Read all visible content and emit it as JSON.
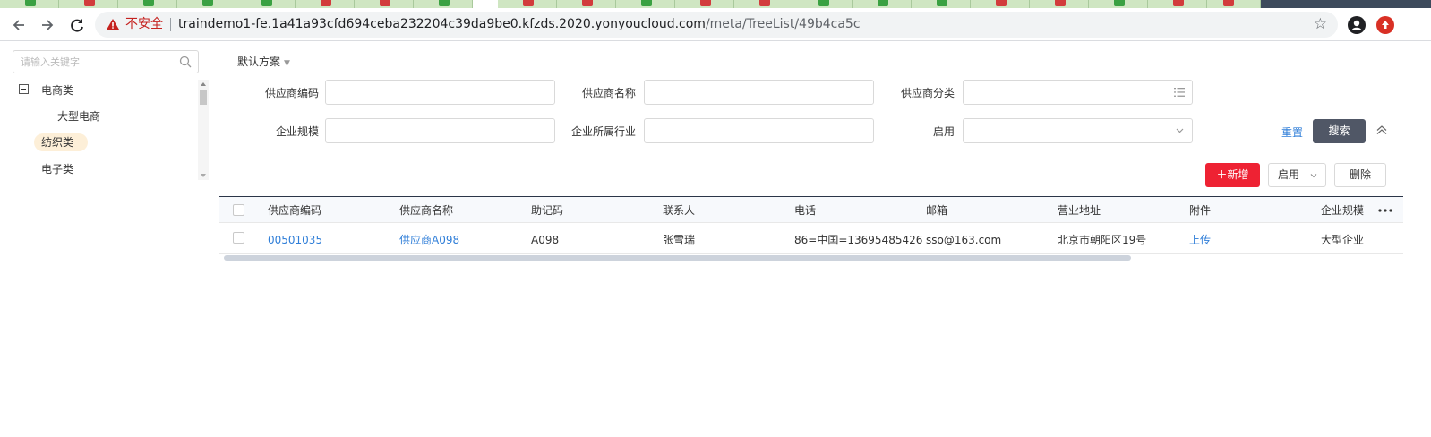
{
  "browser": {
    "security_label": "不安全",
    "url_host": "traindemo1-fe.1a41a93cfd694ceba232204c39da9be0.kfzds.2020.yonyoucloud.com",
    "url_path": "/meta/TreeList/49b4ca5c",
    "back_icon": "arrow-left-icon",
    "forward_icon": "arrow-right-icon",
    "reload_icon": "reload-icon",
    "bookmark_icon": "star-icon",
    "warning_color": "#c5221f"
  },
  "sidebar": {
    "search_placeholder": "请输入关键字",
    "tree": [
      {
        "label": "电商类",
        "expanded": true
      },
      {
        "label": "大型电商"
      },
      {
        "label": "纺织类",
        "selected": true
      },
      {
        "label": "电子类"
      }
    ]
  },
  "filter": {
    "scheme_label": "默认方案",
    "fields": [
      {
        "label": "供应商编码",
        "value": ""
      },
      {
        "label": "供应商名称",
        "value": ""
      },
      {
        "label": "供应商分类",
        "value": ""
      },
      {
        "label": "企业规模",
        "value": ""
      },
      {
        "label": "企业所属行业",
        "value": ""
      },
      {
        "label": "启用",
        "value": ""
      }
    ],
    "reset_label": "重置",
    "search_label": "搜索"
  },
  "actions": {
    "add_label": "新增",
    "enable_label": "启用",
    "delete_label": "删除",
    "add_color": "#ee2233"
  },
  "table": {
    "columns": [
      "供应商编码",
      "供应商名称",
      "助记码",
      "联系人",
      "电话",
      "邮箱",
      "营业地址",
      "附件",
      "企业规模"
    ],
    "rows": [
      [
        "00501035",
        "供应商A098",
        "A098",
        "张雪瑞",
        "86=中国=13695485426",
        "sso@163.com",
        "北京市朝阳区19号",
        "上传",
        "大型企业"
      ]
    ]
  }
}
